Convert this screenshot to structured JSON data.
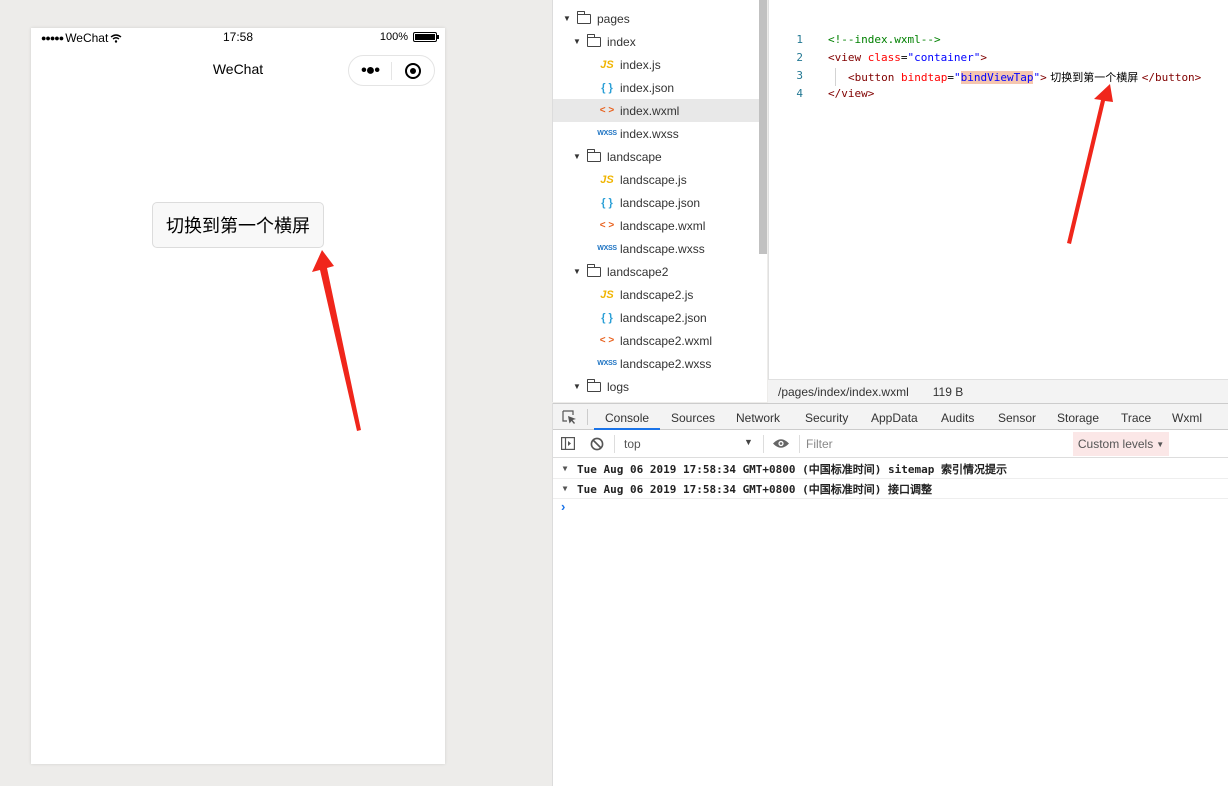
{
  "simulator": {
    "status": {
      "carrier": "WeChat",
      "time": "17:58",
      "battery": "100%",
      "battery_level": 1.0
    },
    "nav": {
      "title": "WeChat"
    },
    "button_label": "切换到第一个横屏"
  },
  "file_tree": {
    "items": [
      {
        "label": "pages",
        "type": "folder",
        "depth": 0
      },
      {
        "label": "index",
        "type": "folder",
        "depth": 1
      },
      {
        "label": "index.js",
        "type": "js",
        "depth": 2
      },
      {
        "label": "index.json",
        "type": "json",
        "depth": 2
      },
      {
        "label": "index.wxml",
        "type": "wxml",
        "depth": 2,
        "selected": true
      },
      {
        "label": "index.wxss",
        "type": "wxss",
        "depth": 2
      },
      {
        "label": "landscape",
        "type": "folder",
        "depth": 1
      },
      {
        "label": "landscape.js",
        "type": "js",
        "depth": 2
      },
      {
        "label": "landscape.json",
        "type": "json",
        "depth": 2
      },
      {
        "label": "landscape.wxml",
        "type": "wxml",
        "depth": 2
      },
      {
        "label": "landscape.wxss",
        "type": "wxss",
        "depth": 2
      },
      {
        "label": "landscape2",
        "type": "folder",
        "depth": 1
      },
      {
        "label": "landscape2.js",
        "type": "js",
        "depth": 2
      },
      {
        "label": "landscape2.json",
        "type": "json",
        "depth": 2
      },
      {
        "label": "landscape2.wxml",
        "type": "wxml",
        "depth": 2
      },
      {
        "label": "landscape2.wxss",
        "type": "wxss",
        "depth": 2
      },
      {
        "label": "logs",
        "type": "folder",
        "depth": 1
      }
    ],
    "icon_glyphs": {
      "js": "JS",
      "json": "{ }",
      "wxml": "< >",
      "wxss": "WXSS"
    }
  },
  "editor": {
    "line_numbers": [
      "1",
      "2",
      "3",
      "4"
    ],
    "line1": {
      "comment": "<!--index.wxml-->"
    },
    "line2": {
      "open": "<view ",
      "attr": "class",
      "eq": "=",
      "val": "\"container\"",
      "close": ">"
    },
    "line3": {
      "open": "<button ",
      "attr": "bindtap",
      "eq": "=",
      "q1": "\"",
      "val": "bindViewTap",
      "q2": "\"",
      "close": ">",
      "text": " 切换到第一个横屏 ",
      "end": "</button>"
    },
    "line4": {
      "end": "</view>"
    },
    "status_path": "/pages/index/index.wxml",
    "status_size": "119 B"
  },
  "devtools": {
    "tabs": [
      "Console",
      "Sources",
      "Network",
      "Security",
      "AppData",
      "Audits",
      "Sensor",
      "Storage",
      "Trace",
      "Wxml"
    ],
    "active_tab": "Console",
    "context": "top",
    "filter_placeholder": "Filter",
    "levels": "Custom levels",
    "messages": [
      "Tue Aug 06 2019 17:58:34 GMT+0800 (中国标准时间) sitemap 索引情况提示",
      "Tue Aug 06 2019 17:58:34 GMT+0800 (中国标准时间) 接口调整"
    ],
    "prompt": "›"
  },
  "colors": {
    "accent": "#1a73e8",
    "arrow": "#f0261b",
    "levels_bg": "#fbe7e7"
  }
}
